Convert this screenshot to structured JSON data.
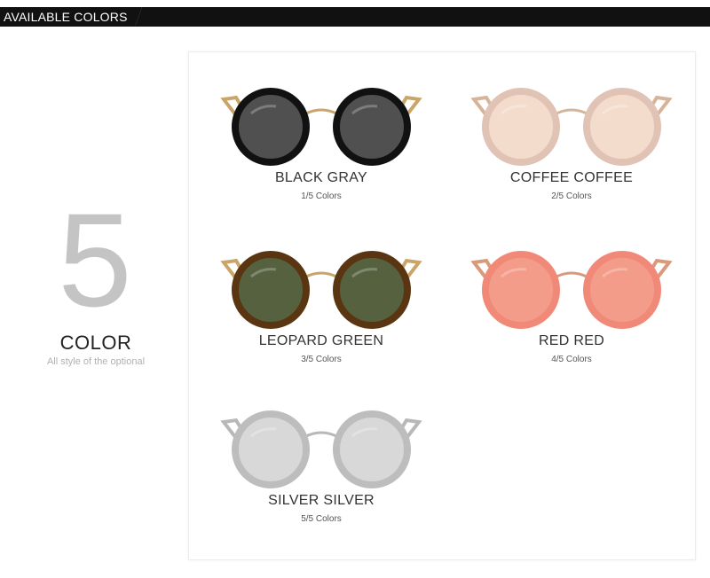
{
  "header": {
    "title": "AVAILABLE COLORS"
  },
  "summary": {
    "count": "5",
    "label": "COLOR",
    "subtitle": "All style of the optional"
  },
  "products": [
    {
      "name": "BLACK GRAY",
      "count": "1/5 Colors",
      "frame": "#111111",
      "lens": "#505050",
      "temple": "#caa56a"
    },
    {
      "name": "COFFEE COFFEE",
      "count": "2/5 Colors",
      "frame": "#e0c3b4",
      "lens": "#f4dccd",
      "temple": "#d6b49a"
    },
    {
      "name": "LEOPARD GREEN",
      "count": "3/5 Colors",
      "frame": "#5a3512",
      "lens": "#55613f",
      "temple": "#caa56a"
    },
    {
      "name": "RED RED",
      "count": "4/5 Colors",
      "frame": "#f08977",
      "lens": "#f49c8a",
      "temple": "#d89a7a"
    },
    {
      "name": "SILVER SILVER",
      "count": "5/5 Colors",
      "frame": "#bdbdbd",
      "lens": "#d8d8d8",
      "temple": "#b8b8b8"
    }
  ]
}
